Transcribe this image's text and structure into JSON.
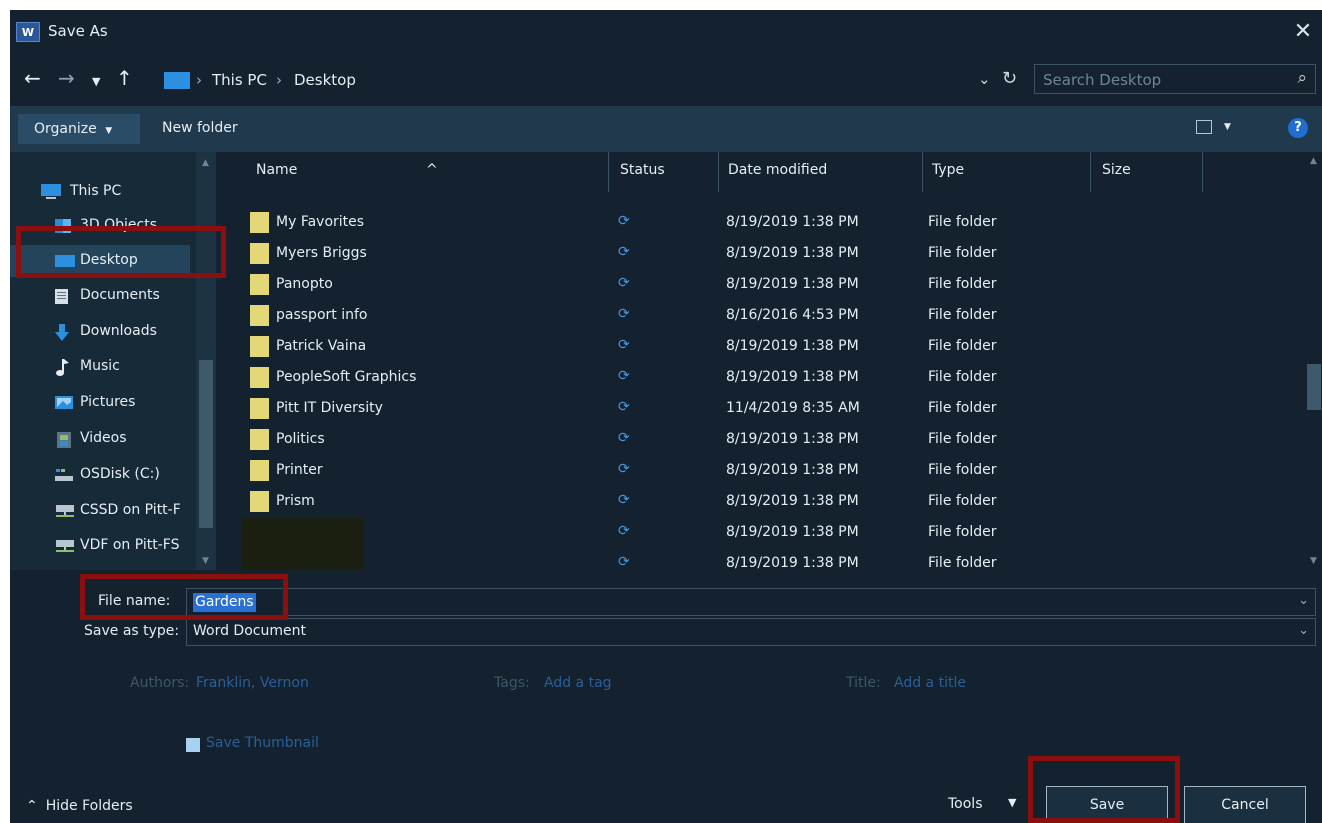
{
  "window": {
    "title": "Save As",
    "app_icon_text": "W"
  },
  "nav": {
    "back_icon": "back-arrow-icon",
    "forward_icon": "forward-arrow-icon",
    "recent_icon": "chevron-down-icon",
    "up_icon": "up-arrow-icon",
    "breadcrumb": [
      "This PC",
      "Desktop"
    ],
    "search_placeholder": "Search Desktop"
  },
  "toolbar": {
    "organize_label": "Organize",
    "new_folder_label": "New folder",
    "help_label": "?"
  },
  "sidebar": {
    "items": [
      {
        "label": "This PC",
        "icon": "computer-icon"
      },
      {
        "label": "3D Objects",
        "icon": "cube-icon"
      },
      {
        "label": "Desktop",
        "icon": "desktop-icon",
        "selected": true
      },
      {
        "label": "Documents",
        "icon": "documents-icon"
      },
      {
        "label": "Downloads",
        "icon": "download-icon"
      },
      {
        "label": "Music",
        "icon": "music-note-icon"
      },
      {
        "label": "Pictures",
        "icon": "pictures-icon"
      },
      {
        "label": "Videos",
        "icon": "film-icon"
      },
      {
        "label": "OSDisk (C:)",
        "icon": "drive-icon"
      },
      {
        "label": "CSSD on Pitt-F",
        "icon": "network-drive-icon"
      },
      {
        "label": "VDF on Pitt-FS",
        "icon": "network-drive-icon"
      }
    ]
  },
  "columns": {
    "name": "Name",
    "status": "Status",
    "date": "Date modified",
    "type": "Type",
    "size": "Size"
  },
  "files": [
    {
      "name": "My Favorites",
      "date": "8/19/2019 1:38 PM",
      "type": "File folder"
    },
    {
      "name": "Myers Briggs",
      "date": "8/19/2019 1:38 PM",
      "type": "File folder"
    },
    {
      "name": "Panopto",
      "date": "8/19/2019 1:38 PM",
      "type": "File folder"
    },
    {
      "name": "passport info",
      "date": "8/16/2016 4:53 PM",
      "type": "File folder"
    },
    {
      "name": "Patrick Vaina",
      "date": "8/19/2019 1:38 PM",
      "type": "File folder"
    },
    {
      "name": "PeopleSoft Graphics",
      "date": "8/19/2019 1:38 PM",
      "type": "File folder"
    },
    {
      "name": "Pitt IT Diversity",
      "date": "11/4/2019 8:35 AM",
      "type": "File folder"
    },
    {
      "name": "Politics",
      "date": "8/19/2019 1:38 PM",
      "type": "File folder"
    },
    {
      "name": "Printer",
      "date": "8/19/2019 1:38 PM",
      "type": "File folder"
    },
    {
      "name": "Prism",
      "date": "8/19/2019 1:38 PM",
      "type": "File folder"
    },
    {
      "name": "",
      "date": "8/19/2019 1:38 PM",
      "type": "File folder"
    },
    {
      "name": "",
      "date": "8/19/2019 1:38 PM",
      "type": "File folder"
    }
  ],
  "form": {
    "file_name_label": "File name:",
    "file_name_value": "Gardens",
    "save_type_label": "Save as type:",
    "save_type_value": "Word Document",
    "authors_label": "Authors:",
    "authors_value": "Franklin, Vernon",
    "tags_label": "Tags:",
    "tags_value": "Add a tag",
    "title_label": "Title:",
    "title_value": "Add a title",
    "thumbnail_label": "Save Thumbnail",
    "thumbnail_checked": true
  },
  "footer": {
    "hide_folders_label": "Hide Folders",
    "tools_label": "Tools",
    "save_label": "Save",
    "cancel_label": "Cancel"
  },
  "colors": {
    "background": "#13222e",
    "toolbar": "#21394c",
    "selection": "#24445b",
    "folder": "#e3d777",
    "highlight": "#8c0f0f",
    "link": "#2b5f9a"
  }
}
